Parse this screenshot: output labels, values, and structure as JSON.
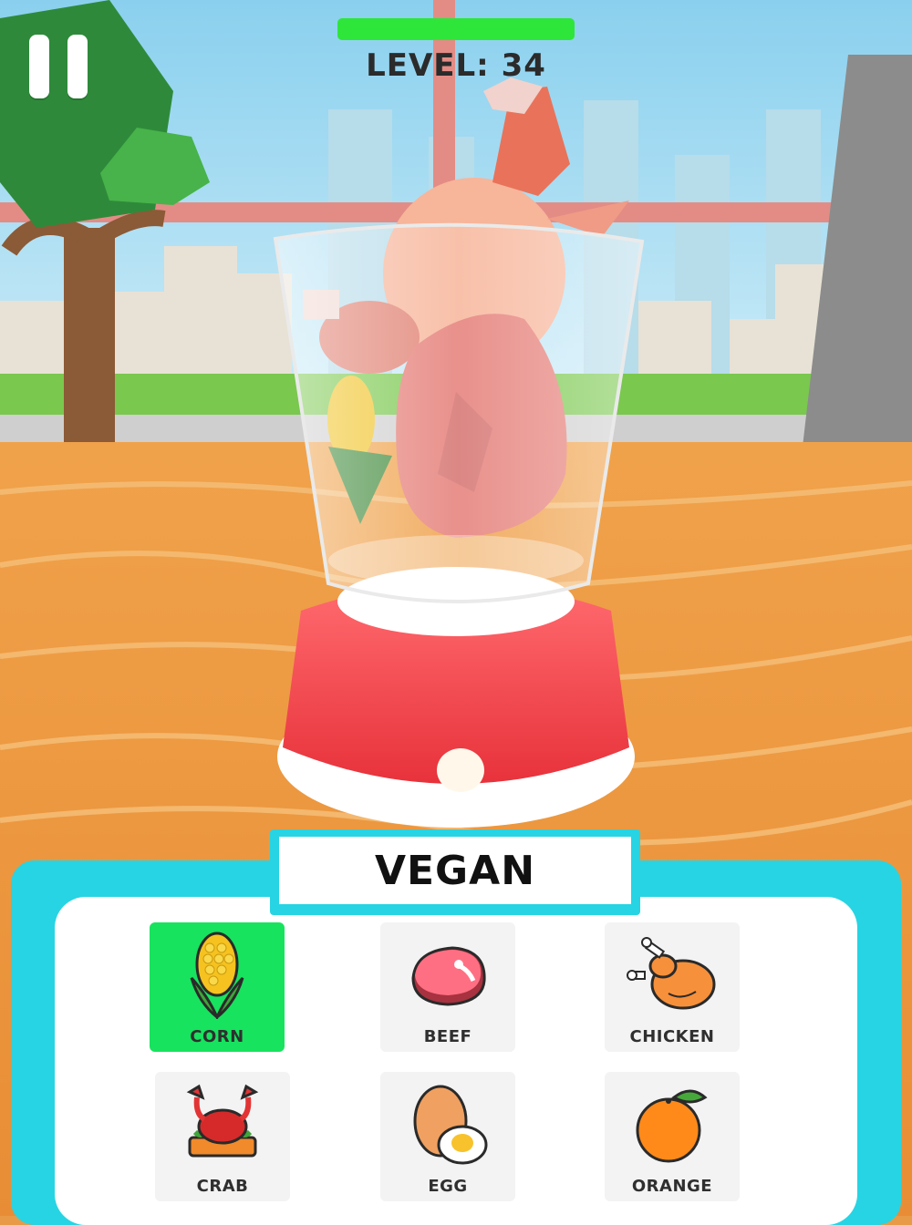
{
  "hud": {
    "progress": 1.0,
    "progress_color": "#2ee53a",
    "level_text": "LEVEL: 34"
  },
  "pause_button": {
    "icon": "pause-icon"
  },
  "category": {
    "label": "VEGAN"
  },
  "food_grid": {
    "items": [
      {
        "label": "CORN",
        "icon": "corn-icon",
        "selected": true
      },
      {
        "label": "BEEF",
        "icon": "beef-icon",
        "selected": false
      },
      {
        "label": "CHICKEN",
        "icon": "chicken-icon",
        "selected": false
      },
      {
        "label": "CRAB",
        "icon": "crab-icon",
        "selected": false
      },
      {
        "label": "EGG",
        "icon": "egg-icon",
        "selected": false
      },
      {
        "label": "ORANGE",
        "icon": "orange-icon",
        "selected": false
      }
    ]
  },
  "colors": {
    "panel_accent": "#27d4e3",
    "selected_card": "#17e35e",
    "blender_base": "#f0434b"
  }
}
